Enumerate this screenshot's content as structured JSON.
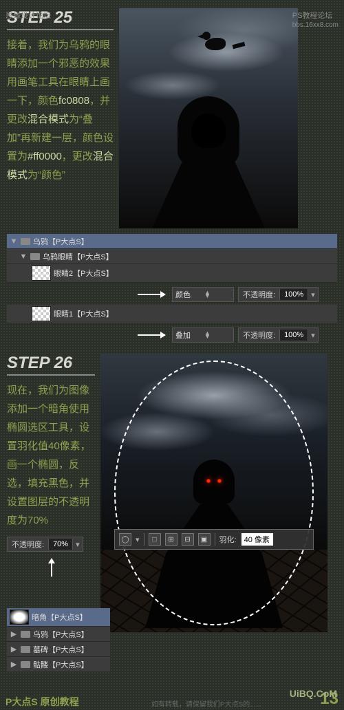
{
  "watermarks": {
    "top_left": "思缘设计论坛",
    "top_right_title": "PS教程论坛",
    "top_right_url": "bbs.16xx8.com",
    "bottom_brand": "P大点S 原创教程",
    "bottom_note": "如有转载，请保留我们P大点S的......",
    "bottom_site": "UiBQ.CoM",
    "page_number": "13"
  },
  "step25": {
    "title": "STEP 25",
    "text_parts": {
      "p1a": "接着，我们为乌鸦的眼睛添加一个邪恶的效果用画笔工具在眼睛上画一下，颜色",
      "p1b": "fc0808",
      "p1c": "，并更改",
      "p1d": "混合模式",
      "p1e": "为“叠加”再新建一层，颜色设置为",
      "p1f": "#ff0000",
      "p1g": "，更改",
      "p1h": "混合模式",
      "p1i": "为“颜色”"
    },
    "layers": {
      "group": "乌鸦【P大点S】",
      "subgroup": "乌鸦眼睛【P大点S】",
      "layer_eye2": "眼睛2【P大点S】",
      "layer_eye1": "眼睛1【P大点S】"
    },
    "blend_mode_color": "颜色",
    "blend_mode_overlay": "叠加",
    "opacity_label": "不透明度:",
    "opacity_value": "100%"
  },
  "step26": {
    "title": "STEP 26",
    "text": "现在，我们为图像添加一个暗角使用椭圆选区工具，设置羽化值40像素，画一个椭圆，反选，填充黑色，并设置图层的不透明度为70%",
    "toolbar": {
      "feather_label": "羽化:",
      "feather_value": "40 像素"
    },
    "opacity_label": "不透明度:",
    "opacity_value": "70%",
    "layers": {
      "vignette": "暗角【P大点S】",
      "crow": "乌鸦【P大点S】",
      "tombstone": "墓碑【P大点S】",
      "skull": "骷髅【P大点S】"
    }
  }
}
